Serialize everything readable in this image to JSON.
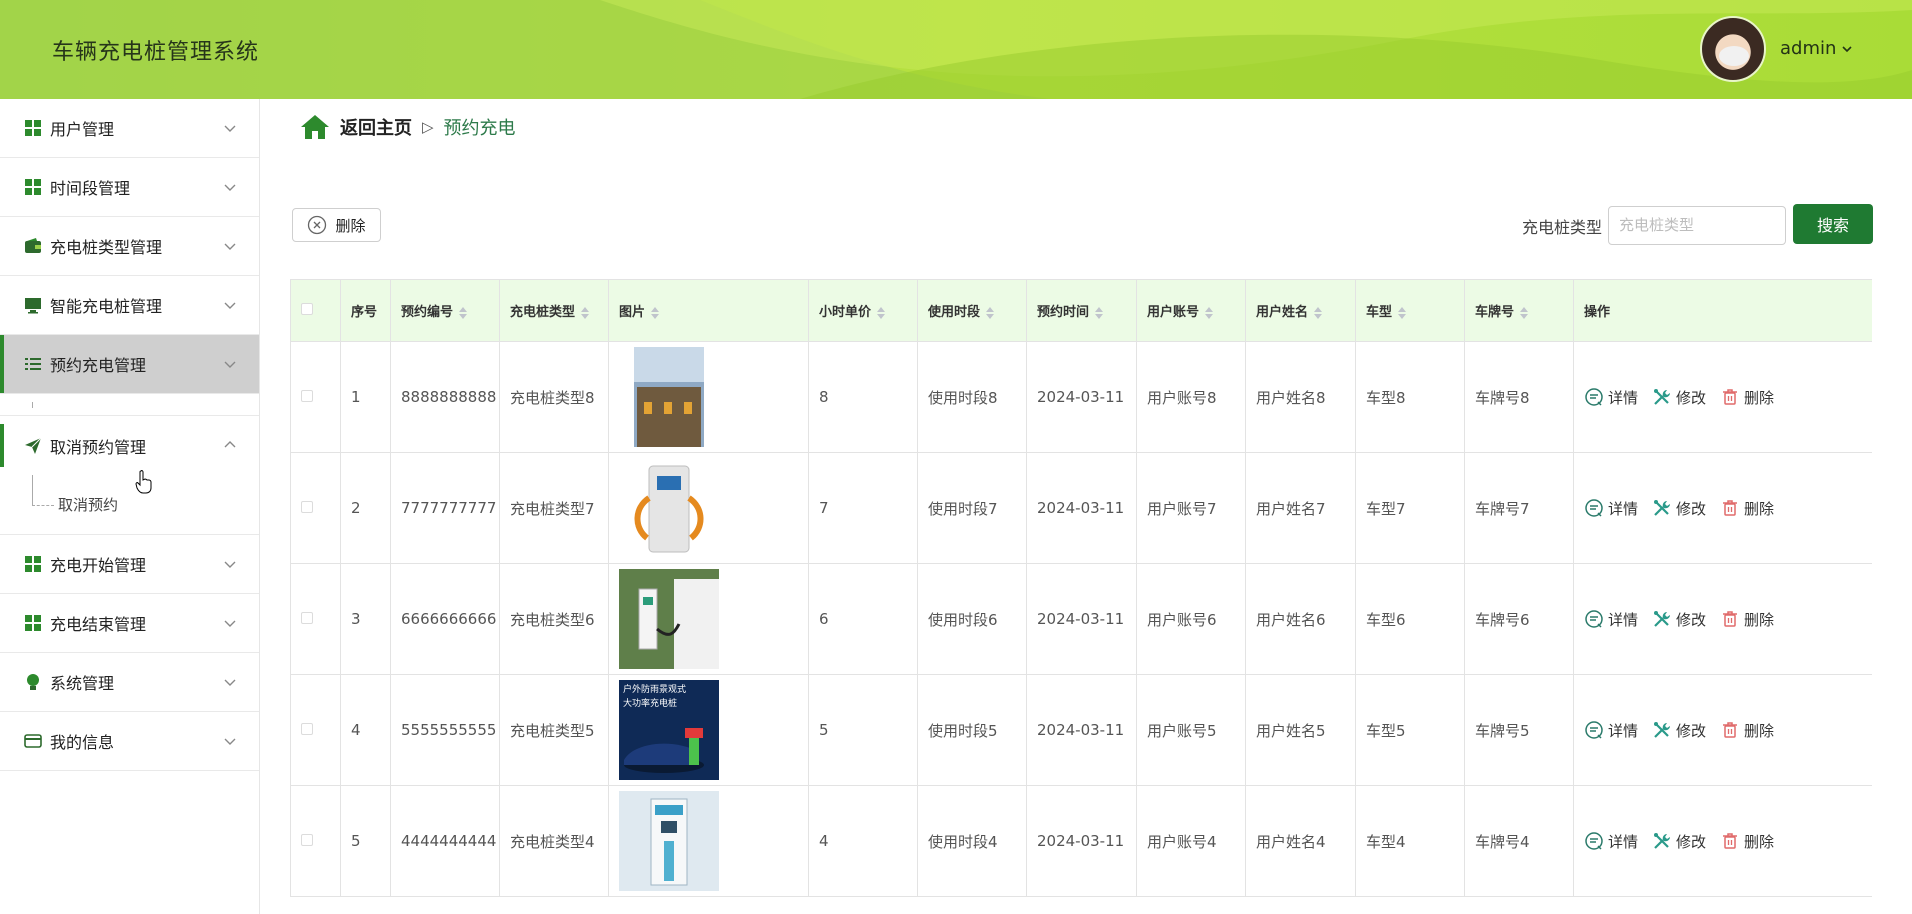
{
  "app": {
    "title": "车辆充电桩管理系统"
  },
  "user": {
    "name": "admin"
  },
  "sidebar": {
    "items": [
      {
        "label": "用户管理",
        "icon": "grid-icon"
      },
      {
        "label": "时间段管理",
        "icon": "grid-icon"
      },
      {
        "label": "充电桩类型管理",
        "icon": "wallet-icon"
      },
      {
        "label": "智能充电桩管理",
        "icon": "monitor-icon"
      },
      {
        "label": "预约充电管理",
        "icon": "list-icon"
      },
      {
        "label": "取消预约管理",
        "icon": "paper-plane-icon",
        "submenu": [
          "取消预约"
        ]
      },
      {
        "label": "充电开始管理",
        "icon": "grid-icon"
      },
      {
        "label": "充电结束管理",
        "icon": "grid-icon"
      },
      {
        "label": "系统管理",
        "icon": "bulb-icon"
      },
      {
        "label": "我的信息",
        "icon": "card-icon"
      }
    ]
  },
  "breadcrumb": {
    "home": "返回主页",
    "separator": "▷",
    "current": "预约充电"
  },
  "toolbar": {
    "delete_label": "删除"
  },
  "search": {
    "label": "充电桩类型",
    "placeholder": "充电桩类型",
    "button": "搜索"
  },
  "table": {
    "headers": [
      "",
      "序号",
      "预约编号",
      "充电桩类型",
      "图片",
      "小时单价",
      "使用时段",
      "预约时间",
      "用户账号",
      "用户姓名",
      "车型",
      "车牌号",
      "操作"
    ],
    "actions": {
      "detail": "详情",
      "edit": "修改",
      "delete": "删除"
    },
    "rows": [
      {
        "index": "1",
        "code": "8888888888",
        "type": "充电桩类型8",
        "price": "8",
        "slot": "使用时段8",
        "time": "2024-03-11",
        "account": "用户账号8",
        "name": "用户姓名8",
        "model": "车型8",
        "plate": "车牌号8"
      },
      {
        "index": "2",
        "code": "7777777777",
        "type": "充电桩类型7",
        "price": "7",
        "slot": "使用时段7",
        "time": "2024-03-11",
        "account": "用户账号7",
        "name": "用户姓名7",
        "model": "车型7",
        "plate": "车牌号7"
      },
      {
        "index": "3",
        "code": "6666666666",
        "type": "充电桩类型6",
        "price": "6",
        "slot": "使用时段6",
        "time": "2024-03-11",
        "account": "用户账号6",
        "name": "用户姓名6",
        "model": "车型6",
        "plate": "车牌号6"
      },
      {
        "index": "4",
        "code": "5555555555",
        "type": "充电桩类型5",
        "price": "5",
        "slot": "使用时段5",
        "time": "2024-03-11",
        "account": "用户账号5",
        "name": "用户姓名5",
        "model": "车型5",
        "plate": "车牌号5",
        "image_text": "户外防雨景观式 大功率充电桩"
      },
      {
        "index": "5",
        "code": "4444444444",
        "type": "充电桩类型4",
        "price": "4",
        "slot": "使用时段4",
        "time": "2024-03-11",
        "account": "用户账号4",
        "name": "用户姓名4",
        "model": "车型4",
        "plate": "车牌号4"
      }
    ]
  },
  "colors": {
    "header_green": "#b3df3d",
    "accent_green": "#1f7a32",
    "table_header_bg": "#ecfbe5"
  }
}
